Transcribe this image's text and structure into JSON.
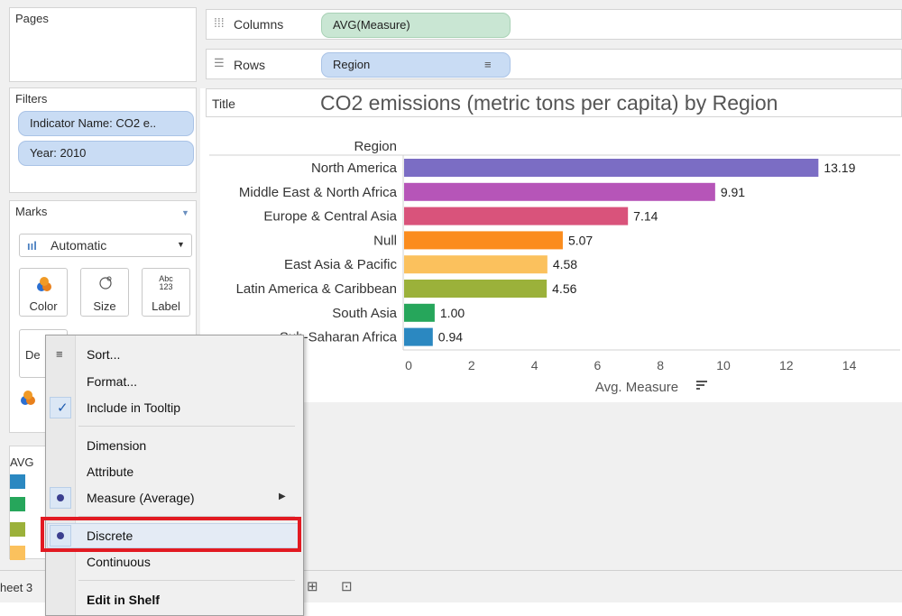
{
  "pages_card": {
    "title": "Pages"
  },
  "filters_card": {
    "title": "Filters",
    "pills": [
      "Indicator Name: CO2 e..",
      "Year: 2010"
    ]
  },
  "marks_card": {
    "title": "Marks",
    "mark_type": "Automatic",
    "buttons": {
      "color": "Color",
      "size": "Size",
      "label": "Label",
      "detail_partial": "De",
      "label_icon_text": [
        "Abc",
        "123"
      ]
    }
  },
  "legend_partial": {
    "title": "AVG",
    "swatch_colors": [
      "#2b88c1",
      "#26a65b",
      "#9bb13a",
      "#fbc15d"
    ]
  },
  "sheet_tab_partial": "heet 3",
  "shelves": {
    "columns": {
      "label": "Columns",
      "pill": "AVG(Measure)"
    },
    "rows": {
      "label": "Rows",
      "pill": "Region"
    }
  },
  "title_bar": {
    "label": "Title",
    "text": "CO2 emissions (metric tons per capita) by Region"
  },
  "chart_data": {
    "type": "bar",
    "orientation": "horizontal",
    "row_header": "Region",
    "categories": [
      "North America",
      "Middle East & North Africa",
      "Europe & Central Asia",
      "Null",
      "East Asia & Pacific",
      "Latin America & Caribbean",
      "South Asia",
      "Sub-Saharan Africa"
    ],
    "values": [
      13.19,
      9.91,
      7.14,
      5.07,
      4.58,
      4.56,
      1.0,
      0.94
    ],
    "value_labels": [
      "13.19",
      "9.91",
      "7.14",
      "5.07",
      "4.58",
      "4.56",
      "1.00",
      "0.94"
    ],
    "colors": [
      "#7b6dc4",
      "#b655b8",
      "#d9537b",
      "#fb8c1e",
      "#fbc15d",
      "#9bb13a",
      "#26a65b",
      "#2b88c1"
    ],
    "xlabel": "Avg. Measure",
    "xlim": [
      0,
      15
    ],
    "xticks": [
      0,
      2,
      4,
      6,
      8,
      10,
      12,
      14
    ]
  },
  "context_menu": {
    "items": [
      {
        "label": "Sort...",
        "glyph": "sort"
      },
      {
        "label": "Format..."
      },
      {
        "label": "Include in Tooltip",
        "checked": true
      },
      {
        "label": "Dimension"
      },
      {
        "label": "Attribute"
      },
      {
        "label": "Measure (Average)",
        "radio": true,
        "submenu": true
      },
      {
        "label": "Discrete",
        "radio": true,
        "highlighted": true
      },
      {
        "label": "Continuous"
      },
      {
        "label": "Edit in Shelf"
      }
    ]
  }
}
